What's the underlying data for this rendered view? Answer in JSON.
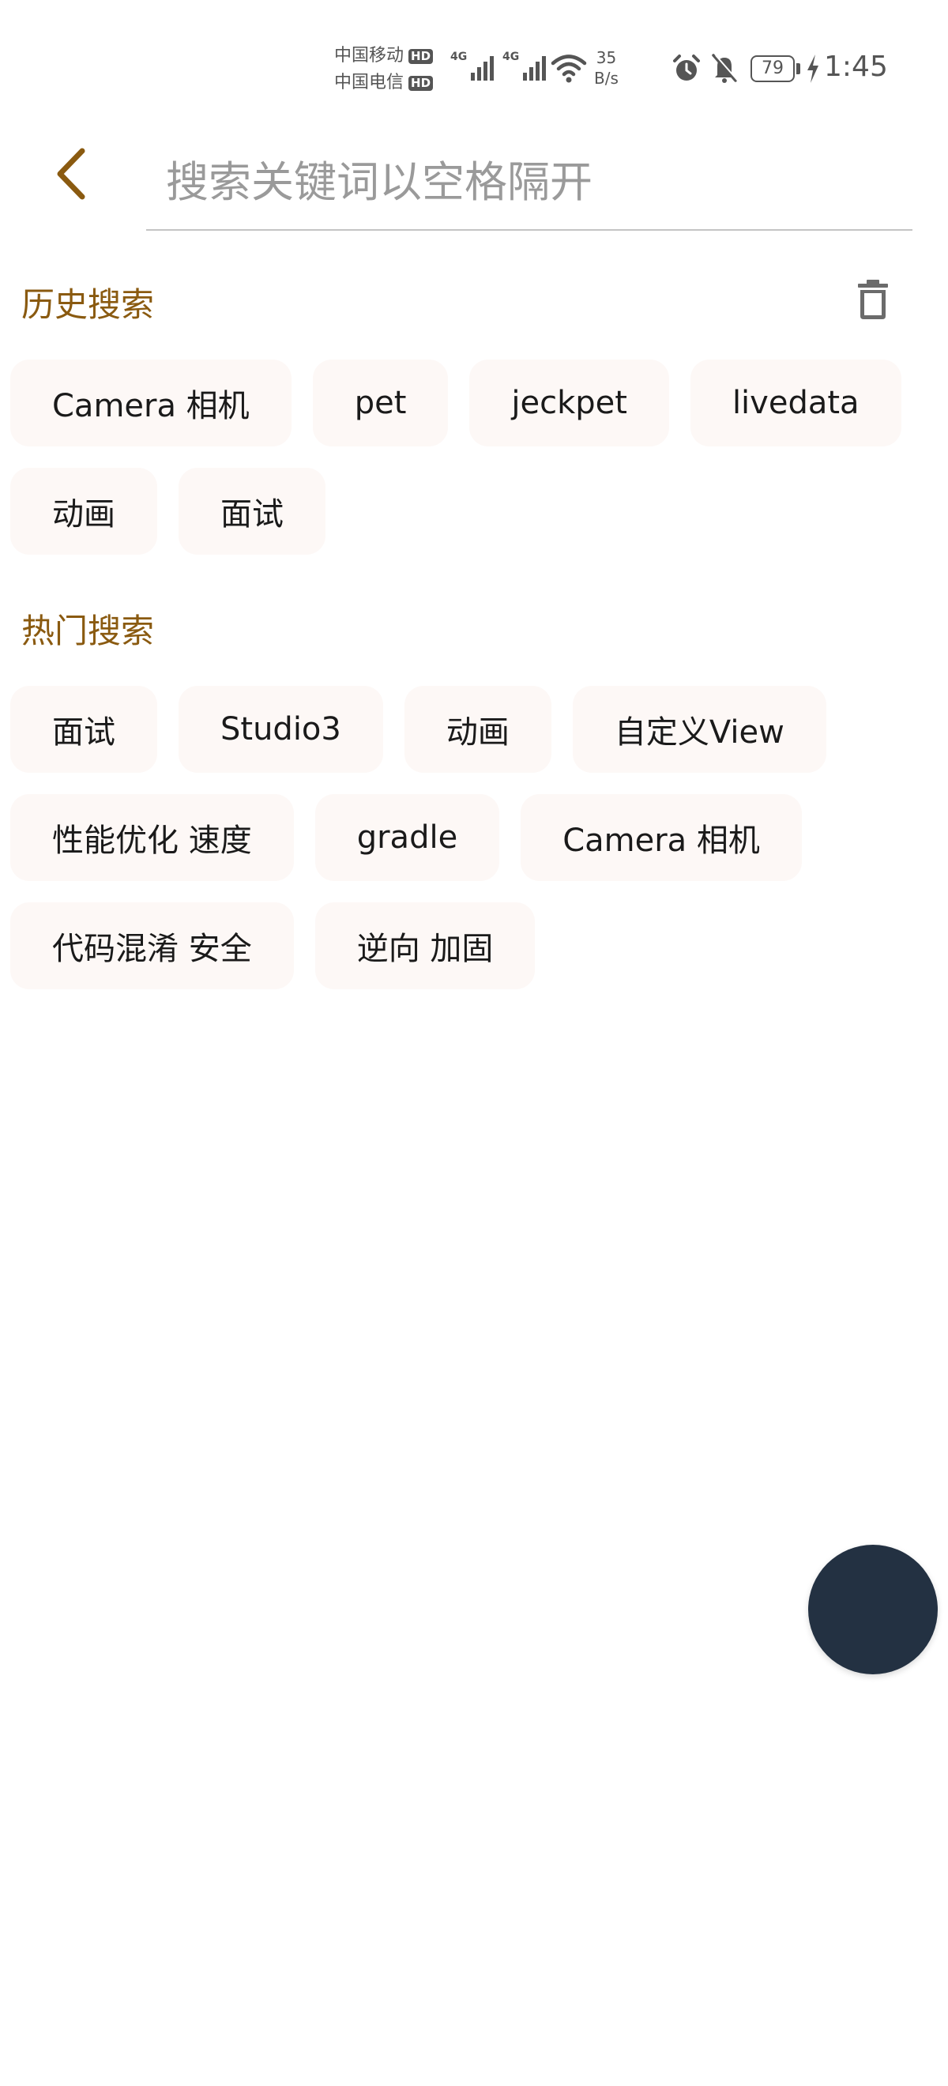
{
  "status_bar": {
    "carrier1": "中国移动",
    "carrier2": "中国电信",
    "hd": "HD",
    "network": "4G",
    "speed_value": "35",
    "speed_unit": "B/s",
    "battery": "79",
    "time": "1:45"
  },
  "search": {
    "placeholder": "搜索关键词以空格隔开",
    "value": ""
  },
  "history": {
    "title": "历史搜索",
    "items": [
      "Camera 相机",
      "pet",
      "jeckpet",
      "livedata",
      "动画",
      "面试"
    ]
  },
  "hot": {
    "title": "热门搜索",
    "items": [
      "面试",
      "Studio3",
      "动画",
      "自定义View",
      "性能优化 速度",
      "gradle",
      "Camera 相机",
      "代码混淆 安全",
      "逆向 加固"
    ]
  },
  "colors": {
    "accent": "#8a5a10",
    "chip_bg": "#fdf8f6",
    "fab": "#233142"
  },
  "icons": {
    "back": "chevron-left-icon",
    "clear_history": "trash-icon"
  }
}
